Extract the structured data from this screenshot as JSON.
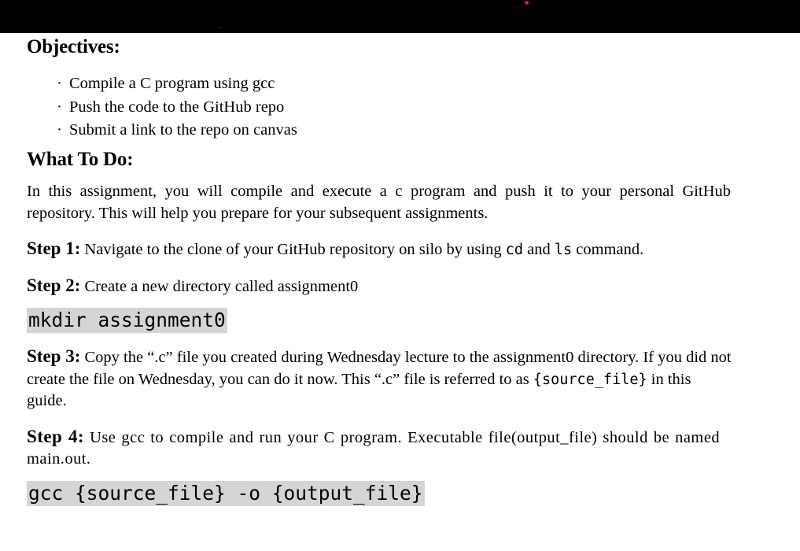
{
  "window": {
    "chrome_bar_color": "#000000",
    "recording_indicator": {
      "name": "recording-dot",
      "color": "#d0232b"
    },
    "clipped_text_above": "g"
  },
  "document": {
    "objectives": {
      "heading": "Objectives:",
      "bullet_glyph": "·",
      "items": [
        "Compile a C program using gcc",
        "Push the code to the GitHub repo",
        "Submit a link to the repo on canvas"
      ]
    },
    "what_to_do": {
      "heading": "What To Do:",
      "intro": "In this assignment, you will compile and execute a c program and push it to your personal GitHub repository. This will help you prepare for your subsequent assignments."
    },
    "steps": [
      {
        "label": "Step 1:",
        "text_before": " Navigate to the clone of your GitHub repository on silo by using ",
        "code_1": "cd",
        "text_middle": "  and ",
        "code_2": "ls",
        "text_after": "  command."
      },
      {
        "label": "Step 2:",
        "text": " Create a new directory called assignment0",
        "code_block": "mkdir assignment0"
      },
      {
        "label": "Step 3:",
        "text_before": " Copy the “.c” file you created during Wednesday lecture to the assignment0 directory.  If you did not create the file on Wednesday, you can do it now. This “.c” file is referred to as ",
        "code_1": "{source_file}",
        "text_after": " in this guide."
      },
      {
        "label": "Step 4:",
        "text": " Use gcc to compile and run your C program. Executable file(output_file) should be named main.out.",
        "code_block": "gcc {source_file} -o {output_file}"
      }
    ],
    "code_block_background": "#d5d5d5"
  }
}
